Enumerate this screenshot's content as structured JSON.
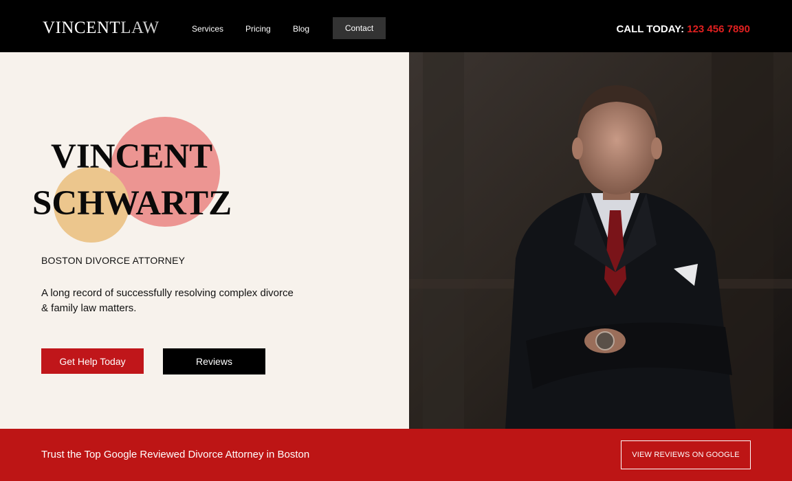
{
  "header": {
    "logo_primary": "VINCENT",
    "logo_secondary": "LAW",
    "nav": {
      "services": "Services",
      "pricing": "Pricing",
      "blog": "Blog",
      "contact": "Contact"
    },
    "call_label": "CALL TODAY:",
    "phone": "123 456 7890"
  },
  "hero": {
    "name_line_1": "VINCENT",
    "name_line_2": "SCHWARTZ",
    "subtitle": "BOSTON DIVORCE ATTORNEY",
    "tagline": "A long record of successfully resolving complex divorce & family law matters.",
    "primary_button": "Get Help Today",
    "secondary_button": "Reviews"
  },
  "banner": {
    "text": "Trust the Top Google Reviewed Divorce Attorney in Boston",
    "button": "VIEW  REVIEWS ON GOOGLE"
  },
  "colors": {
    "accent_red": "#bd1515",
    "circle_red": "#ec9592",
    "circle_yellow": "#ecc68d",
    "background": "#f7f2ec"
  }
}
